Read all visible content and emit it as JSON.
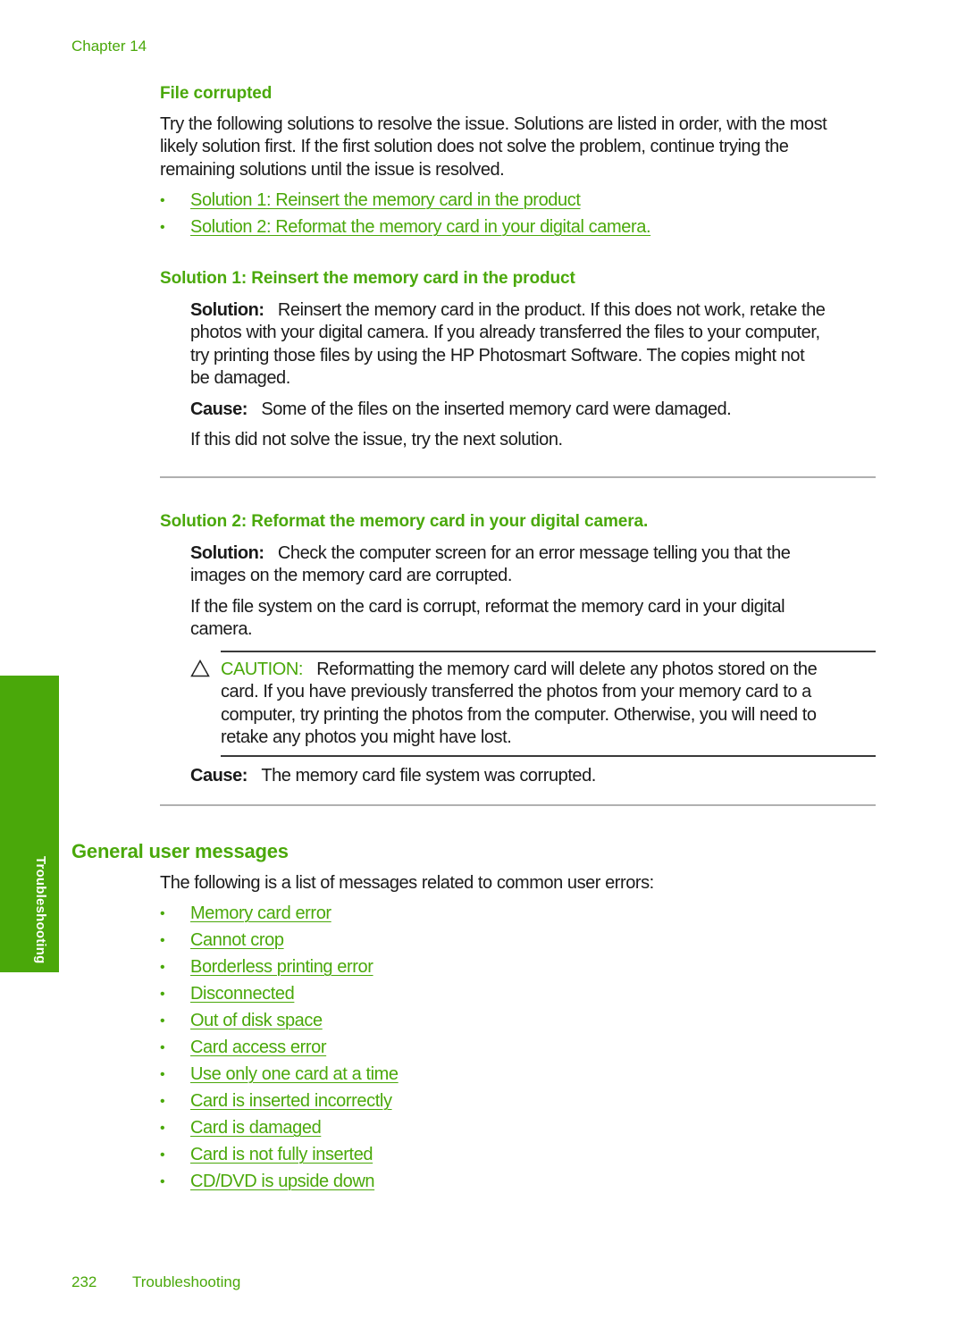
{
  "header": {
    "chapter": "Chapter 14"
  },
  "section_file_corrupted": {
    "title": "File corrupted",
    "intro_lines": [
      "Try the following solutions to resolve the issue. Solutions are listed in order, with the most",
      "likely solution first. If the first solution does not solve the problem, continue trying the",
      "remaining solutions until the issue is resolved."
    ],
    "links": [
      "Solution 1: Reinsert the memory card in the product",
      "Solution 2: Reformat the memory card in your digital camera."
    ]
  },
  "solution1": {
    "title": "Solution 1: Reinsert the memory card in the product",
    "solution_label": "Solution:",
    "solution_lines": [
      "Reinsert the memory card in the product. If this does not work, retake the",
      "photos with your digital camera. If you already transferred the files to your computer,",
      "try printing those files by using the HP Photosmart Software. The copies might not",
      "be damaged."
    ],
    "cause_label": "Cause:",
    "cause_text": "Some of the files on the inserted memory card were damaged.",
    "next_text": "If this did not solve the issue, try the next solution."
  },
  "solution2": {
    "title": "Solution 2: Reformat the memory card in your digital camera.",
    "solution_label": "Solution:",
    "solution_lines": [
      "Check the computer screen for an error message telling you that the",
      "images on the memory card are corrupted."
    ],
    "para_lines": [
      "If the file system on the card is corrupt, reformat the memory card in your digital",
      "camera."
    ],
    "caution": {
      "icon": "warning-triangle-icon",
      "label": "CAUTION:",
      "lines": [
        "Reformatting the memory card will delete any photos stored on the",
        "card. If you have previously transferred the photos from your memory card to a",
        "computer, try printing the photos from the computer. Otherwise, you will need to",
        "retake any photos you might have lost."
      ]
    },
    "cause_label": "Cause:",
    "cause_text": "The memory card file system was corrupted."
  },
  "general_messages": {
    "title": "General user messages",
    "intro": "The following is a list of messages related to common user errors:",
    "links": [
      "Memory card error",
      "Cannot crop",
      "Borderless printing error",
      "Disconnected",
      "Out of disk space",
      "Card access error",
      "Use only one card at a time",
      "Card is inserted incorrectly",
      "Card is damaged",
      "Card is not fully inserted",
      "CD/DVD is upside down"
    ]
  },
  "side_tab": {
    "label": "Troubleshooting"
  },
  "footer": {
    "page_number": "232",
    "section": "Troubleshooting"
  },
  "colors": {
    "accent": "#4aa80a",
    "text": "#1a1a1a",
    "rule": "#b0b0b0"
  }
}
